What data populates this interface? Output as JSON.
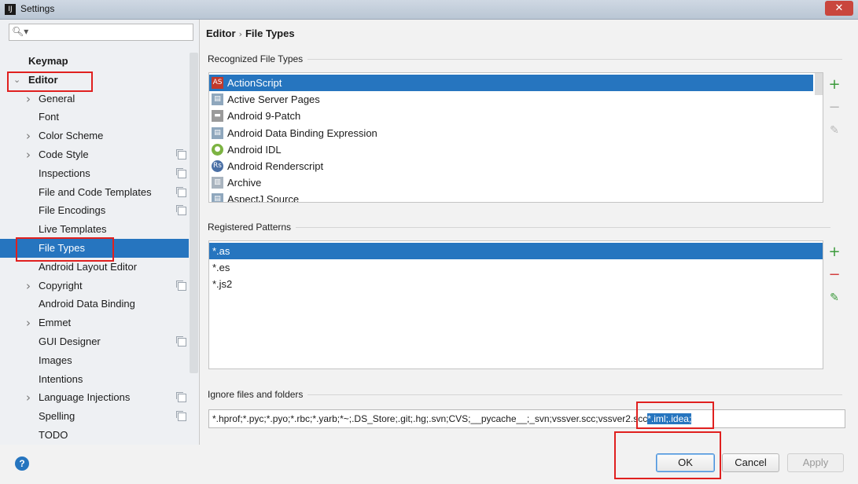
{
  "window": {
    "title": "Settings",
    "app_icon_text": "IJ"
  },
  "search": {
    "placeholder": ""
  },
  "tree": [
    {
      "label": "Keymap",
      "bold": true,
      "arrow": ""
    },
    {
      "label": "Editor",
      "bold": true,
      "arrow": "expanded"
    },
    {
      "label": "General",
      "arrow": "collapsed"
    },
    {
      "label": "Font",
      "arrow": ""
    },
    {
      "label": "Color Scheme",
      "arrow": "collapsed"
    },
    {
      "label": "Code Style",
      "arrow": "collapsed",
      "copy": true
    },
    {
      "label": "Inspections",
      "arrow": "",
      "copy": true
    },
    {
      "label": "File and Code Templates",
      "arrow": "",
      "copy": true
    },
    {
      "label": "File Encodings",
      "arrow": "",
      "copy": true
    },
    {
      "label": "Live Templates",
      "arrow": ""
    },
    {
      "label": "File Types",
      "arrow": "",
      "selected": true
    },
    {
      "label": "Android Layout Editor",
      "arrow": ""
    },
    {
      "label": "Copyright",
      "arrow": "collapsed",
      "copy": true
    },
    {
      "label": "Android Data Binding",
      "arrow": ""
    },
    {
      "label": "Emmet",
      "arrow": "collapsed"
    },
    {
      "label": "GUI Designer",
      "arrow": "",
      "copy": true
    },
    {
      "label": "Images",
      "arrow": ""
    },
    {
      "label": "Intentions",
      "arrow": ""
    },
    {
      "label": "Language Injections",
      "arrow": "collapsed",
      "copy": true
    },
    {
      "label": "Spelling",
      "arrow": "",
      "copy": true
    },
    {
      "label": "TODO",
      "arrow": ""
    }
  ],
  "breadcrumb": {
    "parent": "Editor",
    "separator": "›",
    "current": "File Types"
  },
  "recognized": {
    "label": "Recognized File Types",
    "items": [
      {
        "label": "ActionScript",
        "icon": "actionscript-icon",
        "selected": true
      },
      {
        "label": "Active Server Pages",
        "icon": "asp-file-icon"
      },
      {
        "label": "Android 9-Patch",
        "icon": "folder-icon"
      },
      {
        "label": "Android Data Binding Expression",
        "icon": "data-binding-icon"
      },
      {
        "label": "Android IDL",
        "icon": "android-icon"
      },
      {
        "label": "Android Renderscript",
        "icon": "renderscript-icon"
      },
      {
        "label": "Archive",
        "icon": "archive-icon"
      },
      {
        "label": "AspectJ Source",
        "icon": "aspectj-icon"
      }
    ]
  },
  "patterns": {
    "label": "Registered Patterns",
    "items": [
      "*.as",
      "*.es",
      "*.js2"
    ]
  },
  "ignore": {
    "label": "Ignore files and folders",
    "value_main": "*.hprof;*.pyc;*.pyo;*.rbc;*.yarb;*~;.DS_Store;.git;.hg;.svn;CVS;__pycache__;_svn;vssver.scc;vssver2.scc",
    "value_highlight": "*.iml;.idea;"
  },
  "buttons": {
    "ok": "OK",
    "cancel": "Cancel",
    "apply": "Apply",
    "help": "?"
  },
  "tools": {
    "add": "+",
    "remove": "−",
    "edit": "✎"
  },
  "colors": {
    "accent": "#2675bf",
    "annotation": "#e0201f",
    "add": "#3b9a3b",
    "remove": "#d23d3d"
  }
}
